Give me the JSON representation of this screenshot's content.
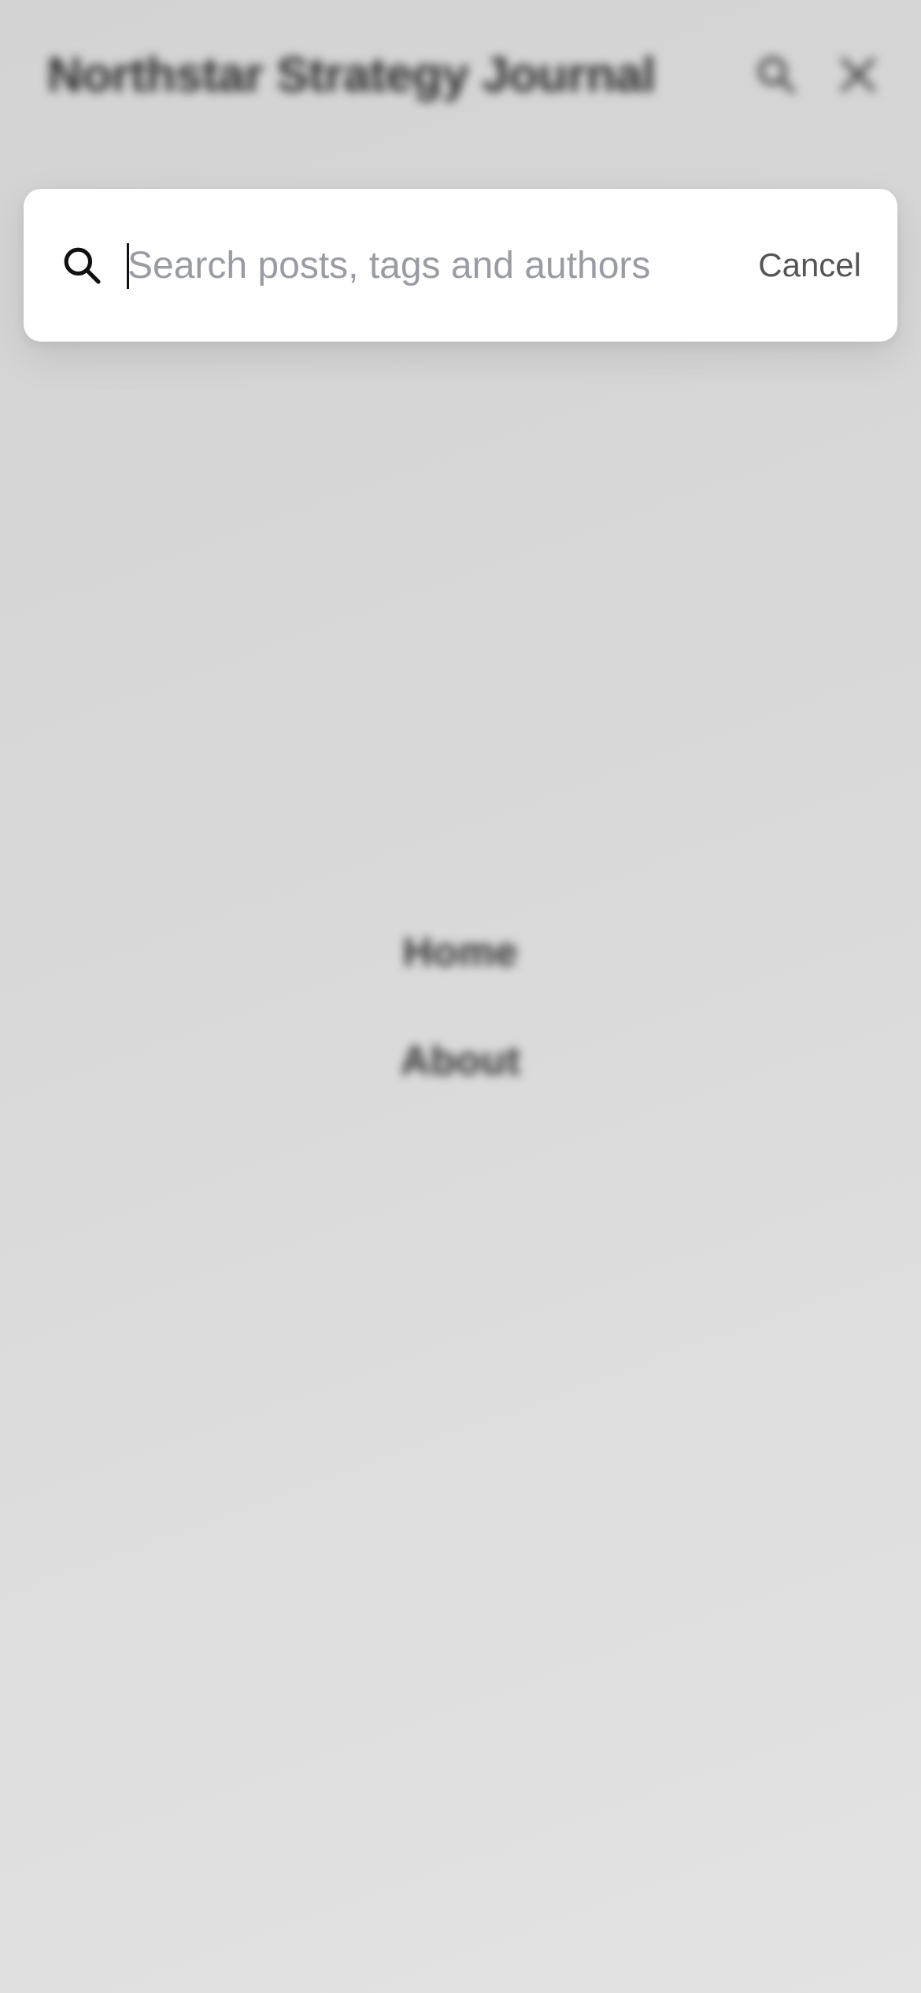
{
  "header": {
    "site_title": "Northstar Strategy Journal",
    "search_icon": "search-icon",
    "close_icon": "close-icon"
  },
  "nav": {
    "items": [
      {
        "label": "Home"
      },
      {
        "label": "About"
      }
    ]
  },
  "search": {
    "value": "",
    "placeholder": "Search posts, tags and authors",
    "icon": "search-icon",
    "cancel_label": "Cancel"
  },
  "colors": {
    "panel_background": "#ffffff",
    "placeholder": "#9a9ca3",
    "cancel_text": "#555555",
    "page_background": "#d9d9d9"
  }
}
